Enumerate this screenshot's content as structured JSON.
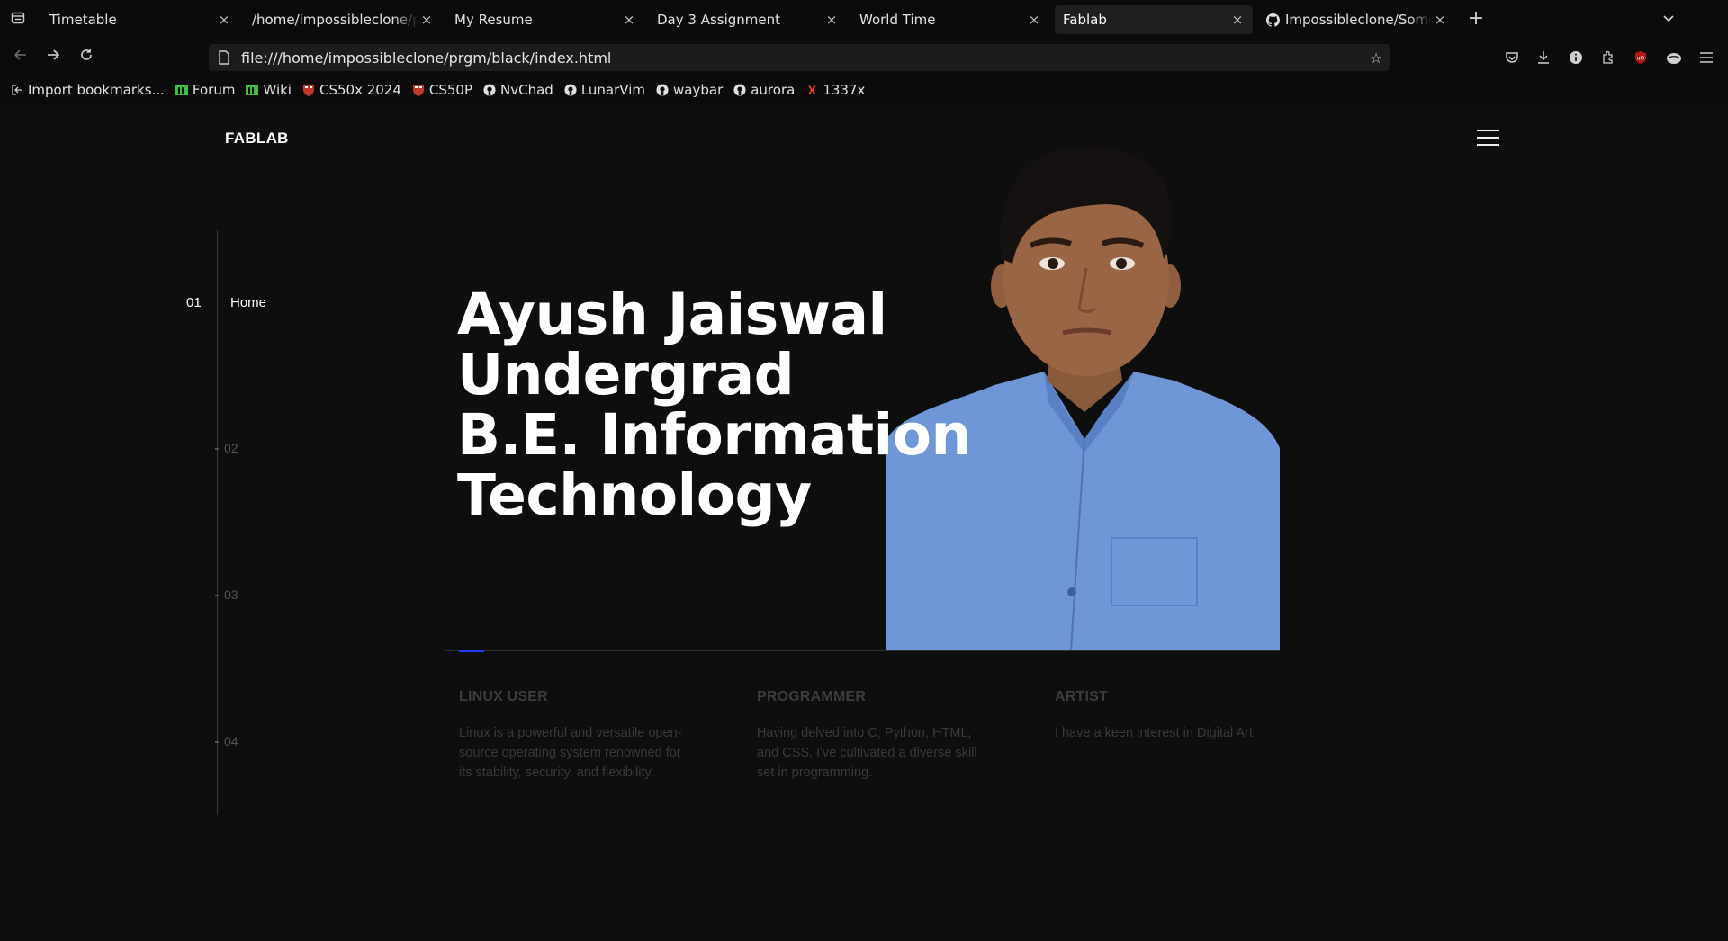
{
  "browser": {
    "tabs": [
      {
        "title": "Timetable",
        "active": false,
        "favicon": "none"
      },
      {
        "title": "/home/impossibleclone/prgm",
        "active": false,
        "favicon": "none"
      },
      {
        "title": "My Resume",
        "active": false,
        "favicon": "none"
      },
      {
        "title": "Day 3 Assignment",
        "active": false,
        "favicon": "none"
      },
      {
        "title": "World Time",
        "active": false,
        "favicon": "none"
      },
      {
        "title": "Fablab",
        "active": true,
        "favicon": "none"
      },
      {
        "title": "Impossibleclone/Something",
        "active": false,
        "favicon": "github-icon"
      }
    ],
    "url": "file:///home/impossibleclone/prgm/black/index.html",
    "bookmarks": [
      {
        "label": "Import bookmarks...",
        "icon": "import-icon",
        "color": "#d0d0d0"
      },
      {
        "label": "Forum",
        "icon": "forum-icon",
        "color": "#3fbf3f"
      },
      {
        "label": "Wiki",
        "icon": "wiki-icon",
        "color": "#3fbf3f"
      },
      {
        "label": "CS50x 2024",
        "icon": "harvard-shield-icon",
        "color": "#c0392b"
      },
      {
        "label": "CS50P",
        "icon": "harvard-shield-icon",
        "color": "#c0392b"
      },
      {
        "label": "NvChad",
        "icon": "github-icon",
        "color": "#e0e0e0"
      },
      {
        "label": "LunarVim",
        "icon": "github-icon",
        "color": "#e0e0e0"
      },
      {
        "label": "waybar",
        "icon": "github-icon",
        "color": "#e0e0e0"
      },
      {
        "label": "aurora",
        "icon": "github-icon",
        "color": "#e0e0e0"
      },
      {
        "label": "1337x",
        "icon": "x-icon",
        "color": "#e8461e"
      }
    ]
  },
  "site": {
    "brand": "FABLAB",
    "steps": [
      {
        "num": "01",
        "label": "Home",
        "active": true
      },
      {
        "num": "02",
        "label": "",
        "active": false
      },
      {
        "num": "03",
        "label": "",
        "active": false
      },
      {
        "num": "04",
        "label": "",
        "active": false
      }
    ],
    "headline": [
      "Ayush Jaiswal",
      "Undergrad",
      "B.E. Information",
      "Technology"
    ],
    "progress": 0.03,
    "accent_color": "#1f3bff",
    "skills": [
      {
        "title": "LINUX USER",
        "text": "Linux is a powerful and versatile open-source operating system renowned for its stability, security, and flexibility."
      },
      {
        "title": "PROGRAMMER",
        "text": "Having delved into C, Python, HTML, and CSS, I've cultivated a diverse skill set in programming."
      },
      {
        "title": "ARTIST",
        "text": "I have a keen interest in Digital Art"
      }
    ]
  }
}
